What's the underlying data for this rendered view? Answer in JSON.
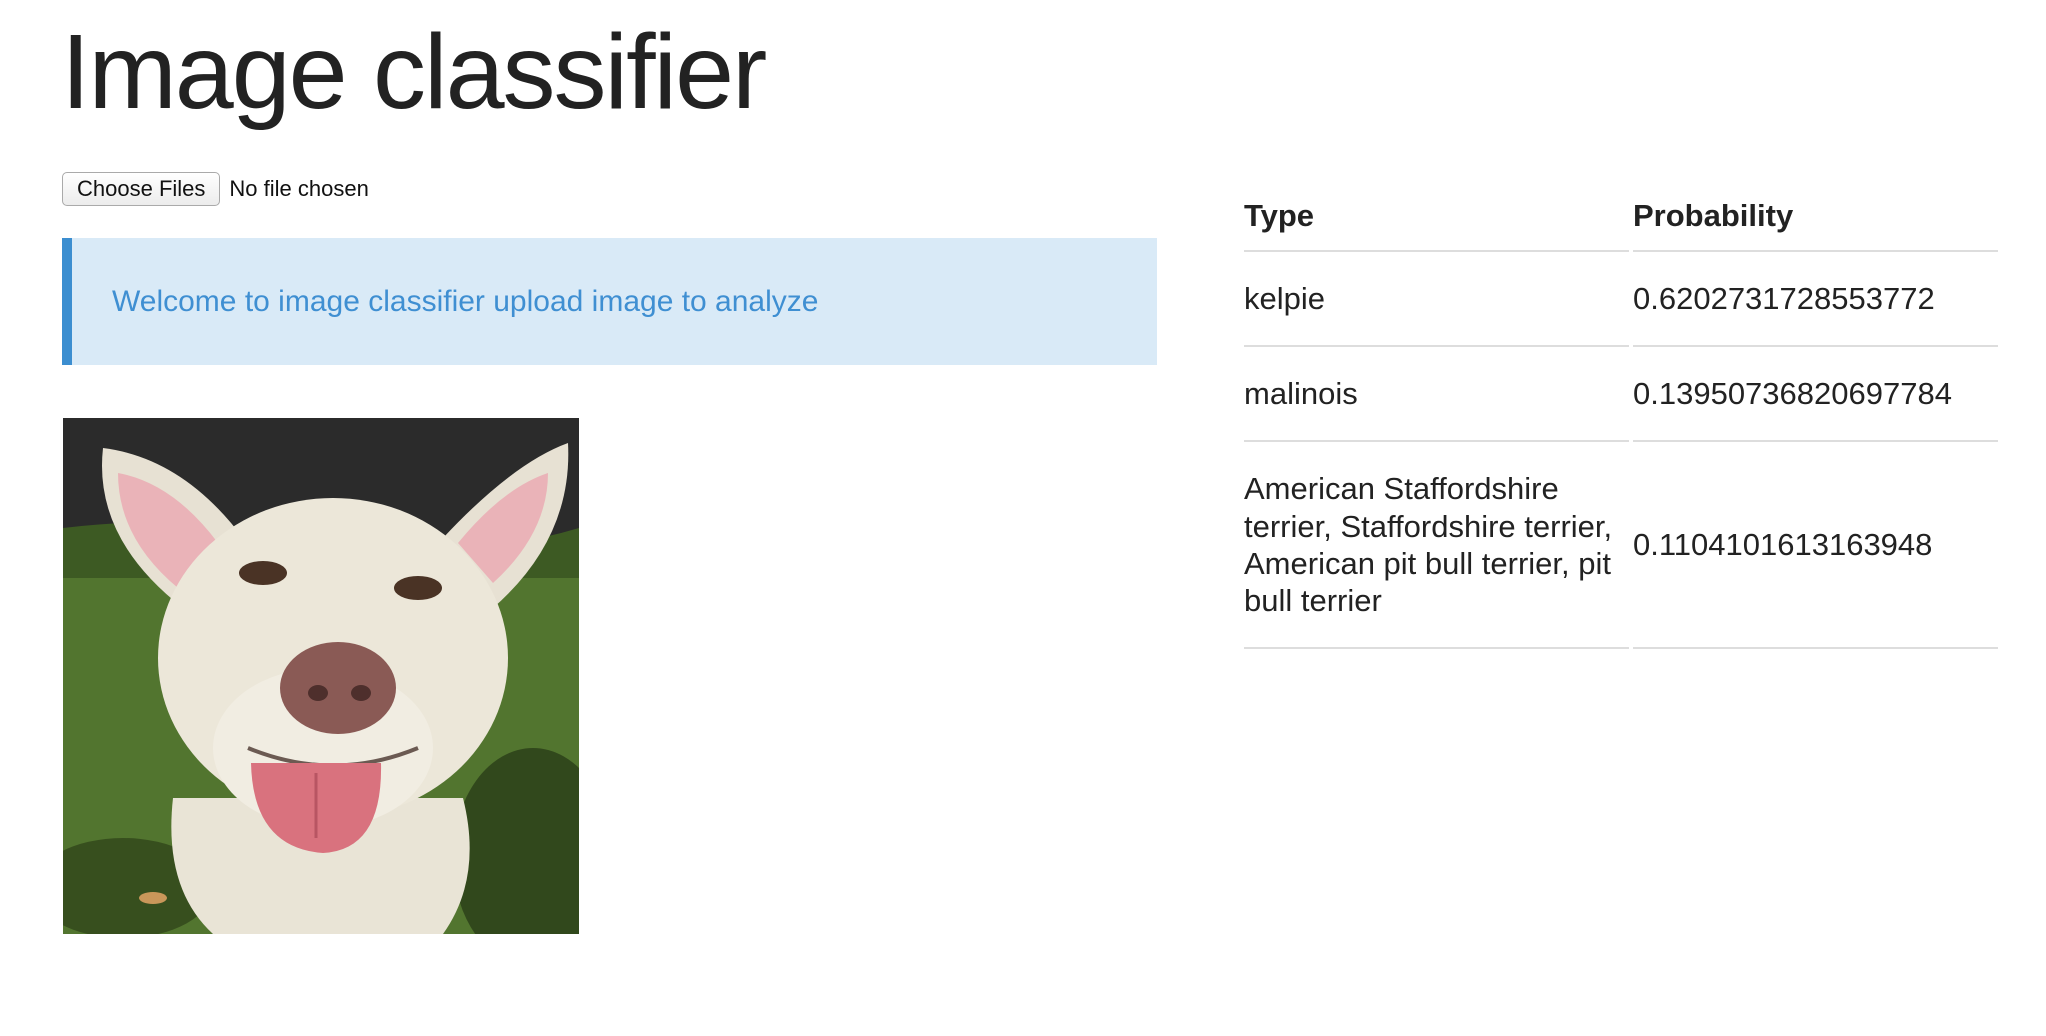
{
  "page": {
    "title": "Image classifier"
  },
  "upload": {
    "button_label": "Choose Files",
    "status": "No file chosen"
  },
  "alert": {
    "message": "Welcome to image classifier upload image to analyze"
  },
  "image": {
    "subject": "dog-photo"
  },
  "results": {
    "headers": {
      "type": "Type",
      "probability": "Probability"
    },
    "rows": [
      {
        "type": "kelpie",
        "probability": "0.6202731728553772"
      },
      {
        "type": "malinois",
        "probability": "0.13950736820697784"
      },
      {
        "type": "American Staffordshire terrier, Staffordshire terrier, American pit bull terrier, pit bull terrier",
        "probability": "0.1104101613163948"
      }
    ]
  },
  "colors": {
    "alert_background": "#d9eaf7",
    "alert_border": "#3c8ed0",
    "alert_text": "#3f8fd2",
    "table_rule": "#dddddd"
  }
}
